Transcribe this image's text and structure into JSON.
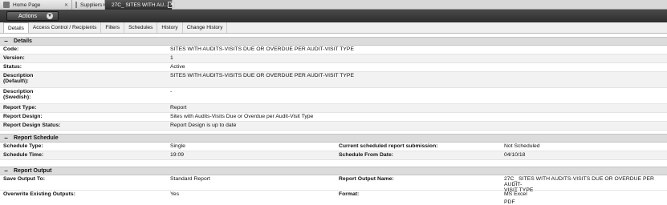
{
  "tabs": [
    {
      "label": "Home Page"
    },
    {
      "label": "Suppliers"
    },
    {
      "label": "27C_ SITES WITH AU..."
    }
  ],
  "toolbar": {
    "actions_label": "Actions"
  },
  "subtabs": [
    "Details",
    "Access Control / Recipients",
    "Filters",
    "Schedules",
    "History",
    "Change History"
  ],
  "details": {
    "title": "Details",
    "code_label": "Code:",
    "code": "SITES WITH AUDITS-VISITS DUE OR OVERDUE PER AUDIT-VISIT TYPE",
    "version_label": "Version:",
    "version": "1",
    "status_label": "Status:",
    "status": "Active",
    "desc_default_label_1": "Description",
    "desc_default_label_2": "(Default\\):",
    "desc_default": "SITES WITH AUDITS-VISITS DUE OR OVERDUE PER AUDIT-VISIT TYPE",
    "desc_swedish_label_1": "Description",
    "desc_swedish_label_2": "(Swedish):",
    "desc_swedish": "-",
    "report_type_label": "Report Type:",
    "report_type": "Report",
    "report_design_label": "Report Design:",
    "report_design": "Sites with Audits-Visits Due or Overdue per Audit-Visit Type",
    "report_design_status_label": "Report Design Status:",
    "report_design_status": "Report Design is up to date"
  },
  "schedule": {
    "title": "Report Schedule",
    "type_label": "Schedule Type:",
    "type": "Single",
    "current_label": "Current scheduled report submission:",
    "current": "Not Scheduled",
    "time_label": "Schedule Time:",
    "time": "19:09",
    "from_date_label": "Schedule From Date:",
    "from_date": "04/10/18"
  },
  "output": {
    "title": "Report Output",
    "save_to_label": "Save Output To:",
    "save_to": "Standard Report",
    "name_label": "Report Output Name:",
    "name_1": "27C_ SITES WITH AUDITS-VISITS DUE OR OVERDUE PER AUDIT-",
    "name_2": "VISIT TYPE",
    "overwrite_label": "Overwrite Existing Outputs:",
    "overwrite": "Yes",
    "format_label": "Format:",
    "format_1": "MS Excel",
    "format_2": "PDF"
  }
}
